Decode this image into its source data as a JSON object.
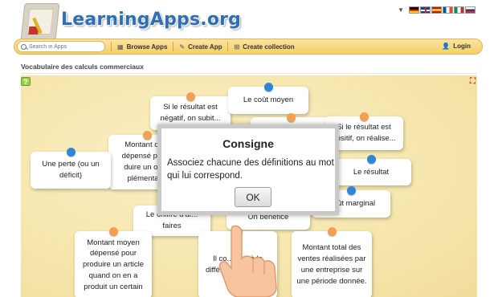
{
  "header": {
    "logo_text": "LearningApps.org",
    "languages": [
      "de",
      "en",
      "es",
      "fr",
      "it",
      "ru"
    ]
  },
  "nav": {
    "search_placeholder": "Search in Apps",
    "browse_label": "Browse Apps",
    "create_label": "Create App",
    "collection_label": "Create collection",
    "login_label": "Login"
  },
  "page": {
    "title": "Vocabulaire des calculs commerciaux"
  },
  "cards": [
    {
      "text": "Si le résultat est négatif, on subit...",
      "pin": "orange"
    },
    {
      "text": "Le coût moyen",
      "pin": "blue"
    },
    {
      "text": "Si le résultat est positif, on réalise...",
      "pin": "orange"
    },
    {
      "text": "Montant qu... dépensé pou... duire un obj... plémentai...",
      "pin": "orange"
    },
    {
      "text": "Une perte (ou un déficit)",
      "pin": "blue"
    },
    {
      "text": "Le résultat",
      "pin": "blue"
    },
    {
      "text": "...oût marginal",
      "pin": "blue"
    },
    {
      "text": "Le chiffre d'af... faires",
      "pin": "blue"
    },
    {
      "text": "Un bénéfice",
      "pin": "orange"
    },
    {
      "text": "Montant moyen dépensé pour produire un article quand on en a produit un certain",
      "pin": "orange"
    },
    {
      "text": "Il co... ond à la différ... chiff... t... ...",
      "pin": "orange"
    },
    {
      "text": "Montant total des ventes réalisées par une entreprise sur une période donnée.",
      "pin": "orange"
    }
  ],
  "modal": {
    "title": "Consigne",
    "text": "Associez chacune des définitions au mot qui lui correspond.",
    "ok_label": "OK"
  },
  "colors": {
    "accent": "#2f6fb3",
    "nav_bg": "#f4cf6b",
    "pin_blue": "#2f86d8",
    "pin_orange": "#f2a150"
  },
  "icons": [
    "search-icon",
    "grid-icon",
    "pencil-icon",
    "collection-icon",
    "user-icon",
    "help-icon",
    "fullscreen-icon",
    "hand-pointer-icon"
  ]
}
